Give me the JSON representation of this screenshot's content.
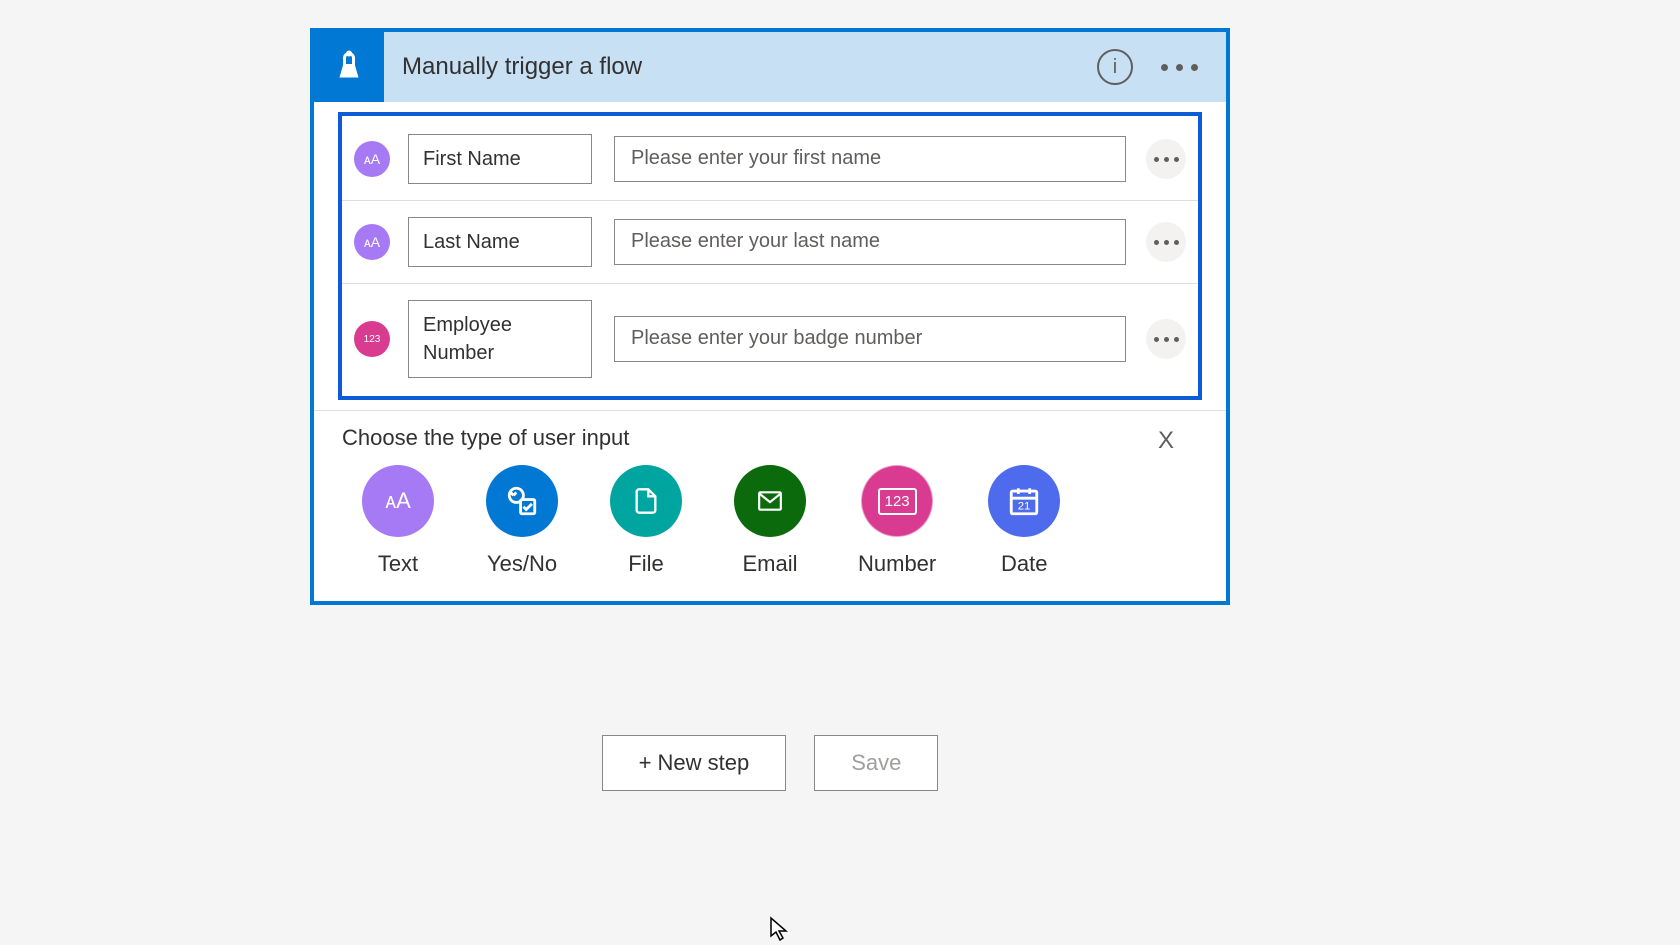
{
  "trigger": {
    "title": "Manually trigger a flow"
  },
  "inputs": [
    {
      "type": "text",
      "label": "First Name",
      "placeholder": "Please enter your first name"
    },
    {
      "type": "text",
      "label": "Last Name",
      "placeholder": "Please enter your last name"
    },
    {
      "type": "number",
      "label": "Employee Number",
      "placeholder": "Please enter your badge number"
    }
  ],
  "chooser": {
    "title": "Choose the type of user input",
    "options": [
      {
        "key": "text",
        "label": "Text"
      },
      {
        "key": "yesno",
        "label": "Yes/No"
      },
      {
        "key": "file",
        "label": "File"
      },
      {
        "key": "email",
        "label": "Email"
      },
      {
        "key": "number",
        "label": "Number"
      },
      {
        "key": "date",
        "label": "Date"
      }
    ]
  },
  "footer": {
    "new_step": "+ New step",
    "save": "Save"
  }
}
